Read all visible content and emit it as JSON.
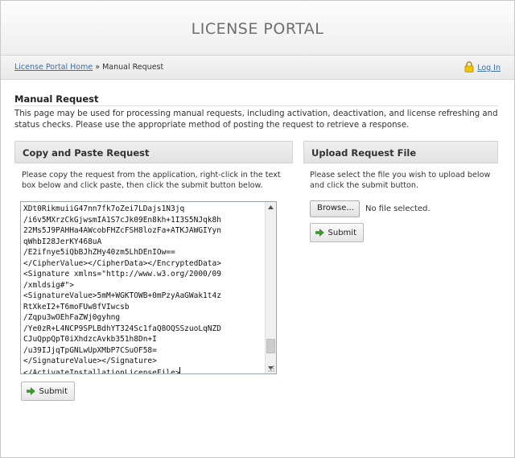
{
  "header": {
    "title": "LICENSE PORTAL"
  },
  "breadcrumb": {
    "home_link": "License Portal Home",
    "separator": " » ",
    "current": "Manual Request"
  },
  "auth": {
    "login_label": "Log In",
    "lock_color": "#e8b400"
  },
  "page": {
    "title": "Manual Request",
    "intro": "This page may be used for processing manual requests, including activation, deactivation, and license refreshing and status checks. Please use the appropriate method of posting the request to retrieve a response."
  },
  "copy_paste": {
    "heading": "Copy and Paste Request",
    "description": "Please copy the request from the application, right-click in the text box below and click paste, then click the submit button below.",
    "textarea_lines": [
      "XDt0RikmuiiG47nn7fk7oZei7LDajs1N3jq",
      "/i6v5MXrzCkGjwsmIA1S7cJk09En8kh+1I3S5NJqk8h",
      "22Ms5J9PAHHa4AWcobFHZcFSH8lozFa+ATKJAWGIYyn",
      "qWhbI28JerKY468uA",
      "/E2ifnye5iQbBJhZHy40zm5LhDEnIOw==",
      "</CipherValue></CipherData></EncryptedData>",
      "<Signature xmlns=\"http://www.w3.org/2000/09",
      "/xmldsig#\">",
      "<SignatureValue>5mM+WGKTOWB+0mPzyAaGWak1t4z",
      "RtXkeI2+T6moFUw8fVIwcsb",
      "/Zqpu3wOEhFaZWj0gyhng",
      "/Ye0zR+L4NCP9SPLBdhYT324Sc1faQ8OQSSzuoLqNZD",
      "CJuQppQpT0iXhdzcAvkb351h8Dn+I",
      "/u39IJjqTpGNLwUpXMbP7CSuOF58=",
      "</SignatureValue></Signature>",
      "</ActivateInstallationLicenseFile>"
    ],
    "scroll_position": 0.92,
    "submit_label": "Submit"
  },
  "upload": {
    "heading": "Upload Request File",
    "description": "Please select the file you wish to upload below and click the submit button.",
    "browse_label": "Browse...",
    "file_status": "No file selected.",
    "submit_label": "Submit"
  },
  "colors": {
    "link": "#3a6fa8",
    "submit_arrow": "#3a9a2c"
  }
}
